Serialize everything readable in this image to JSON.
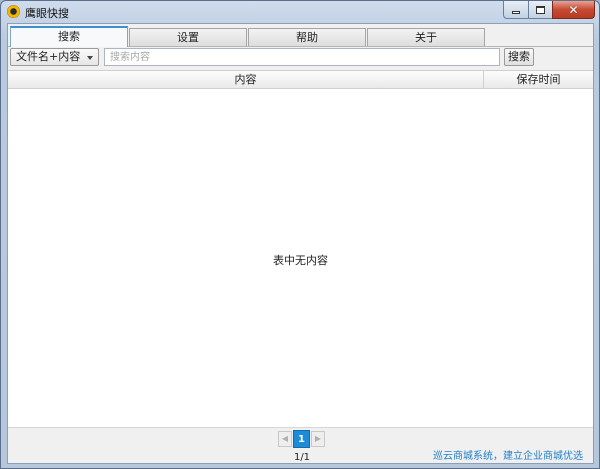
{
  "window": {
    "title": "鹰眼快搜",
    "icon": "eagle-eye-app-icon",
    "controls": {
      "minimize": "minimize-icon",
      "maximize": "maximize-icon",
      "close": "close-icon"
    }
  },
  "tabs": [
    {
      "label": "搜索",
      "active": true
    },
    {
      "label": "设置",
      "active": false
    },
    {
      "label": "帮助",
      "active": false
    },
    {
      "label": "关于",
      "active": false
    }
  ],
  "search": {
    "mode_selected": "文件名+内容",
    "placeholder": "搜索内容",
    "value": "",
    "button_label": "搜索"
  },
  "table": {
    "columns": [
      "内容",
      "保存时间"
    ],
    "rows": [],
    "empty_text": "表中无内容"
  },
  "pagination": {
    "prev_icon": "chevron-left-icon",
    "next_icon": "chevron-right-icon",
    "current_page": "1",
    "page_count": "1/1"
  },
  "footer": {
    "promo_link": "巡云商城系统，建立企业商城优选"
  },
  "colors": {
    "accent": "#1d8bd8",
    "link": "#1f7fc9",
    "close_button": "#c74a32"
  }
}
